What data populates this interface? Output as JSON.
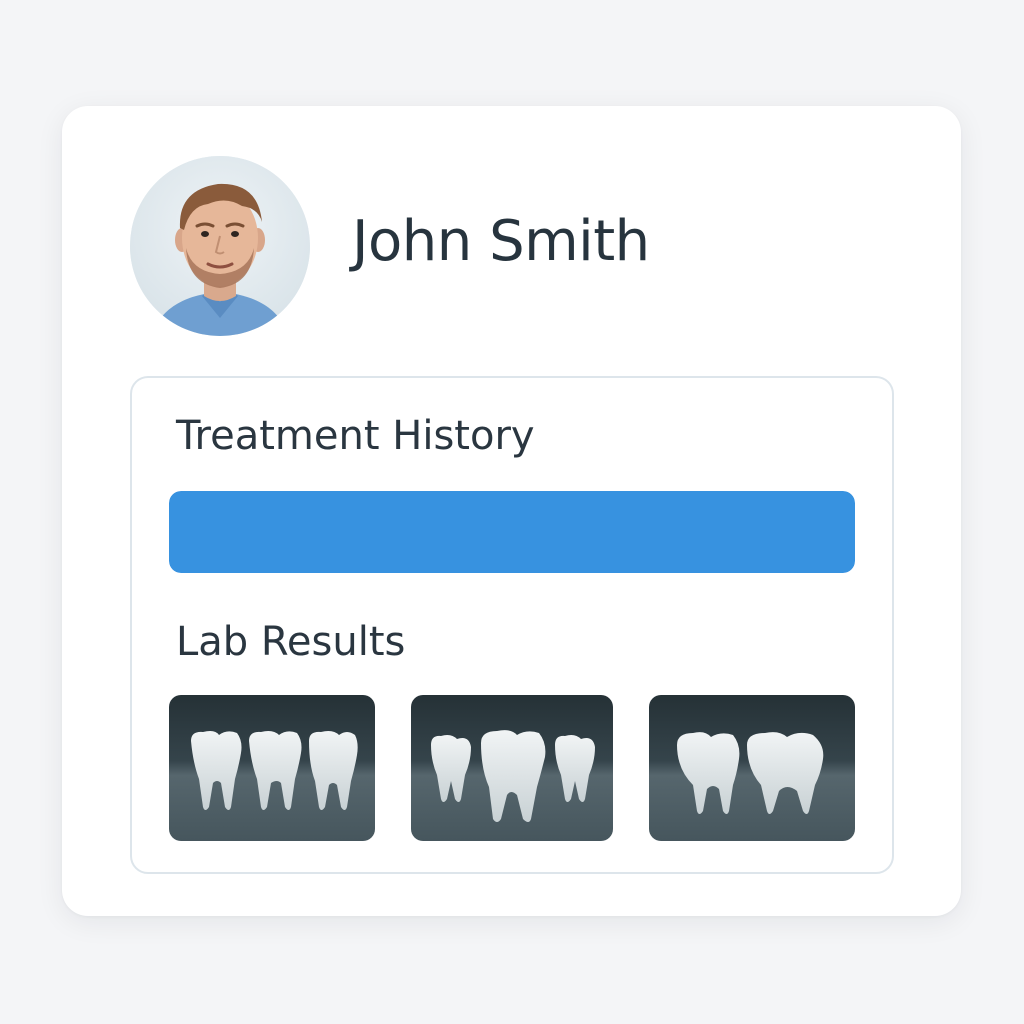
{
  "patient": {
    "name": "John Smith",
    "avatar_icon": "patient-photo"
  },
  "treatment_history": {
    "title": "Treatment History",
    "progress_percent": 100,
    "bar_color": "#3792e0"
  },
  "lab_results": {
    "title": "Lab Results",
    "images": [
      {
        "icon": "xray-three-molars-icon"
      },
      {
        "icon": "xray-mixed-teeth-icon"
      },
      {
        "icon": "xray-two-molars-icon"
      }
    ]
  },
  "colors": {
    "background": "#f4f5f7",
    "card": "#ffffff",
    "text": "#27343e",
    "accent": "#3792e0",
    "xray_dark": "#263339"
  }
}
